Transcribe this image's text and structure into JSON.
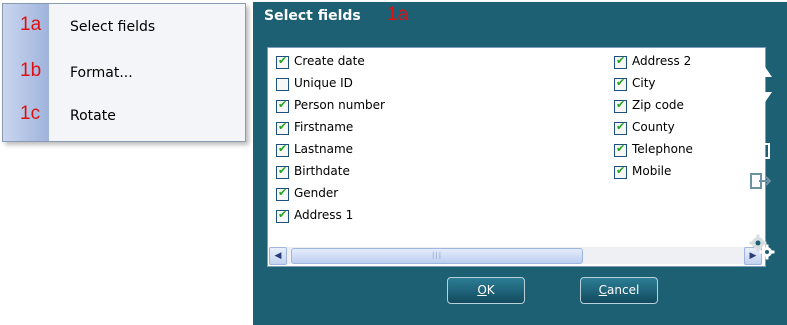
{
  "context_menu": {
    "items": [
      {
        "number": "1a",
        "label": "Select fields"
      },
      {
        "number": "1b",
        "label": "Format..."
      },
      {
        "number": "1c",
        "label": "Rotate"
      }
    ]
  },
  "dialog": {
    "title": "Select fields",
    "title_number": "1a",
    "fields_left": [
      {
        "label": "Create date",
        "checked": true
      },
      {
        "label": "Unique ID",
        "checked": false
      },
      {
        "label": "Person number",
        "checked": true
      },
      {
        "label": "Firstname",
        "checked": true
      },
      {
        "label": "Lastname",
        "checked": true
      },
      {
        "label": "Birthdate",
        "checked": true
      },
      {
        "label": "Gender",
        "checked": true
      },
      {
        "label": "Address 1",
        "checked": true
      }
    ],
    "fields_right": [
      {
        "label": "Address 2",
        "checked": true
      },
      {
        "label": "City",
        "checked": true
      },
      {
        "label": "Zip code",
        "checked": true
      },
      {
        "label": "County",
        "checked": true
      },
      {
        "label": "Telephone",
        "checked": true
      },
      {
        "label": "Mobile",
        "checked": true
      }
    ],
    "ok_label": "OK",
    "ok_mnemonic": "O",
    "ok_rest": "K",
    "cancel_label": "Cancel",
    "cancel_mnemonic": "C",
    "cancel_rest": "ancel",
    "colors": {
      "dialog_bg": "#1d5f73",
      "number_red": "#e01010",
      "check_green": "#21a121"
    },
    "icons": [
      "move-up-icon",
      "move-down-icon",
      "add-field-icon",
      "remove-field-icon",
      "settings-gears-icon"
    ]
  }
}
